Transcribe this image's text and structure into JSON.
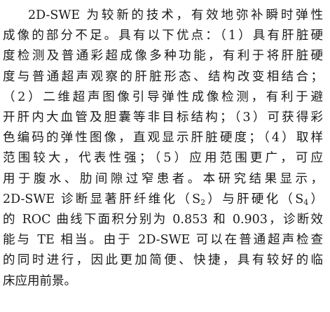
{
  "document": {
    "lines": [
      {
        "pre": "2D-SWE 为较新的技术，有效地弥补瞬时弹性"
      },
      {
        "pre": "成像的部分不足。具有以下优点：（1）具有肝脏硬"
      },
      {
        "pre": "度检测及普通彩超成像多种功能，有利于将肝脏硬"
      },
      {
        "pre": "度与普通超声观察的肝脏形态、结构改变相结合；"
      },
      {
        "pre": "（2）二维超声图像引导弹性成像检测，有利于避"
      },
      {
        "pre": "开肝内大血管及胆囊等非目标结构；（3）可获得彩"
      },
      {
        "pre": "色编码的弹性图像，直观显示肝脏硬度；（4）取样"
      },
      {
        "pre": "范围较大，代表性强；（5）应用范围更广，可应"
      },
      {
        "pre": "用于腹水、肋间隙过窄患者。本研究结果显示，"
      },
      {
        "pre": "2D-SWE 诊断显著肝纤维化（S",
        "sub1": "2",
        "mid": "）与肝硬化（S",
        "sub2": "4",
        "post": "）"
      },
      {
        "pre": "的 ROC 曲线下面积分别为 0.853 和 0.903，诊断效"
      },
      {
        "pre": "能与 TE 相当。由于 2D-SWE 可以在普通超声检查"
      },
      {
        "pre": "的同时进行，因此更加简便、快捷，具有较好的临"
      },
      {
        "pre": "床应用前景。"
      }
    ]
  }
}
